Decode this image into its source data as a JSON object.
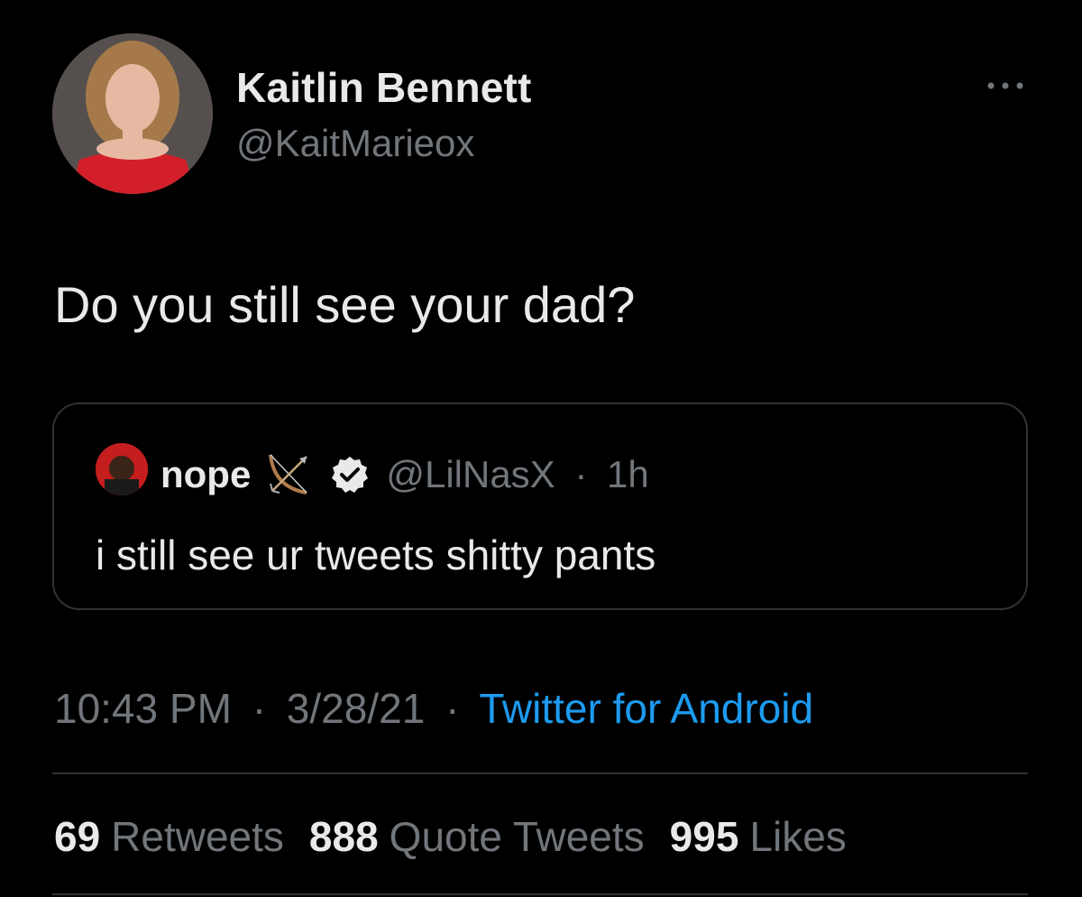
{
  "author": {
    "name": "Kaitlin Bennett",
    "handle": "@KaitMarieox"
  },
  "tweet": {
    "text": "Do you still see your dad?"
  },
  "quoted_tweet": {
    "name": "nope",
    "handle": "@LilNasX",
    "separator": "·",
    "time": "1h",
    "text": "i still see ur tweets shitty pants",
    "icons": [
      "bow-and-arrow-icon",
      "verified-badge-icon"
    ]
  },
  "meta": {
    "time": "10:43 PM",
    "sep1": "·",
    "date": "3/28/21",
    "sep2": "·",
    "source": "Twitter for Android"
  },
  "stats": {
    "retweets_count": "69",
    "retweets_label": "Retweets",
    "quotes_count": "888",
    "quotes_label": "Quote Tweets",
    "likes_count": "995",
    "likes_label": "Likes"
  },
  "colors": {
    "background": "#000000",
    "primary_text": "#e7e9ea",
    "secondary_text": "#71767b",
    "link": "#1d9bf0",
    "border": "#2f3336"
  }
}
